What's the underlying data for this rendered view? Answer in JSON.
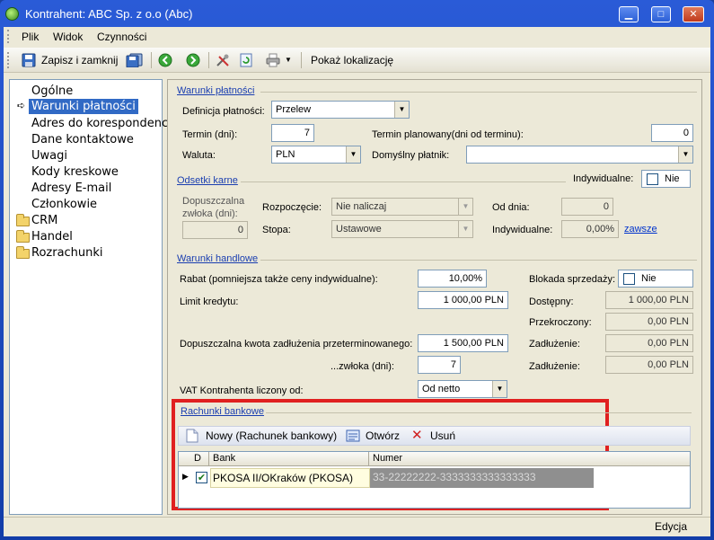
{
  "window": {
    "title": "Kontrahent: ABC Sp. z o.o (Abc)",
    "controls": {
      "minimize": "▁",
      "maximize": "□",
      "close": "✕"
    }
  },
  "menu": [
    "Plik",
    "Widok",
    "Czynności"
  ],
  "toolbar": {
    "save_close": "Zapisz i zamknij",
    "show_location": "Pokaż lokalizację"
  },
  "nav": {
    "items": [
      "Ogólne",
      "Warunki płatności",
      "Adres do korespondencji",
      "Dane kontaktowe",
      "Uwagi",
      "Kody kreskowe",
      "Adresy E-mail",
      "Członkowie"
    ],
    "folders": [
      "CRM",
      "Handel",
      "Rozrachunki"
    ]
  },
  "payment": {
    "section": "Warunki płatności",
    "definition_label": "Definicja płatności:",
    "definition_value": "Przelew",
    "term_label": "Termin (dni):",
    "term_value": "7",
    "planned_label": "Termin planowany(dni od terminu):",
    "planned_value": "0",
    "currency_label": "Waluta:",
    "currency_value": "PLN",
    "payer_label": "Domyślny płatnik:",
    "payer_value": ""
  },
  "interest": {
    "section": "Odsetki karne",
    "individual_label": "Indywidualne:",
    "individual_check": "Nie",
    "delay_label": "Dopuszczalna zwłoka (dni):",
    "delay_value": "0",
    "start_label": "Rozpoczęcie:",
    "start_value": "Nie naliczaj",
    "from_day_label": "Od dnia:",
    "from_day_value": "0",
    "rate_label": "Stopa:",
    "rate_value": "Ustawowe",
    "ind_rate_label": "Indywidualne:",
    "ind_rate_value": "0,00%",
    "always_link": "zawsze"
  },
  "trade": {
    "section": "Warunki handlowe",
    "discount_label": "Rabat (pomniejsza także ceny indywidualne):",
    "discount_value": "10,00%",
    "block_label": "Blokada sprzedaży:",
    "block_check": "Nie",
    "credit_label": "Limit kredytu:",
    "credit_value": "1 000,00 PLN",
    "available_label": "Dostępny:",
    "available_value": "1 000,00 PLN",
    "exceeded_label": "Przekroczony:",
    "exceeded_value": "0,00 PLN",
    "overdue_label": "Dopuszczalna kwota zadłużenia przeterminowanego:",
    "overdue_value": "1 500,00 PLN",
    "debt_label": "Zadłużenie:",
    "debt_value": "0,00 PLN",
    "grace_label": "...zwłoka (dni):",
    "grace_value": "7",
    "debt2_label": "Zadłużenie:",
    "debt2_value": "0,00 PLN",
    "vat_label": "VAT Kontrahenta liczony od:",
    "vat_value": "Od netto"
  },
  "bank": {
    "section": "Rachunki bankowe",
    "new_btn": "Nowy (Rachunek bankowy)",
    "open_btn": "Otwórz",
    "delete_btn": "Usuń",
    "columns": [
      "D",
      "Bank",
      "Numer"
    ],
    "rows": [
      {
        "bank": "PKOSA II/OKraków (PKOSA)",
        "number": "33-22222222-3333333333333333"
      }
    ]
  },
  "status": {
    "mode": "Edycja"
  },
  "colors": {
    "accent": "#316ac5",
    "highlight": "#e02020",
    "section": "#1a3eb0"
  }
}
